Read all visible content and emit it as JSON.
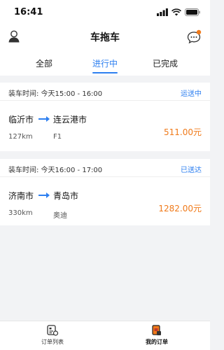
{
  "status_bar": {
    "time": "16:41"
  },
  "header": {
    "title": "车拖车"
  },
  "tabs": [
    {
      "label": "全部"
    },
    {
      "label": "进行中"
    },
    {
      "label": "已完成"
    }
  ],
  "orders": [
    {
      "load_time": "装车时间: 今天15:00 - 16:00",
      "status": "运送中",
      "from": "临沂市",
      "to": "连云港市",
      "distance": "127km",
      "vehicle": "F1",
      "price": "511.00元"
    },
    {
      "load_time": "装车时间: 今天16:00 - 17:00",
      "status": "已送达",
      "from": "济南市",
      "to": "青岛市",
      "distance": "330km",
      "vehicle": "奥迪",
      "price": "1282.00元"
    }
  ],
  "bottom_nav": [
    {
      "label": "订单列表",
      "icon": "order-list-icon"
    },
    {
      "label": "我的订单",
      "icon": "my-orders-icon"
    }
  ],
  "colors": {
    "accent": "#2d7ff0",
    "price": "#f07a1a",
    "badge": "#f07a1a"
  }
}
